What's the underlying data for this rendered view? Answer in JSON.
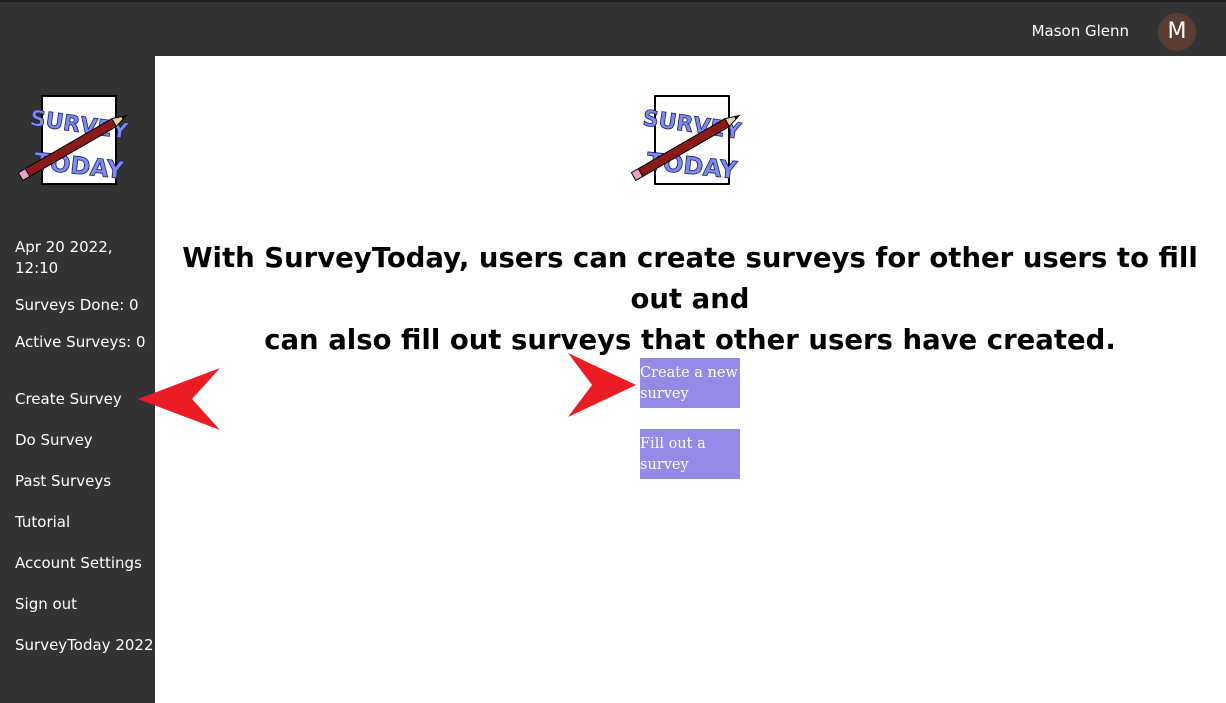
{
  "header": {
    "user_name": "Mason Glenn",
    "avatar_initial": "M"
  },
  "sidebar": {
    "datetime_line1": "Apr 20 2022,",
    "datetime_line2": "12:10",
    "surveys_done": "Surveys Done: 0",
    "active_surveys": "Active Surveys: 0",
    "nav": [
      {
        "label": "Create Survey"
      },
      {
        "label": "Do Survey"
      },
      {
        "label": "Past Surveys"
      },
      {
        "label": "Tutorial"
      },
      {
        "label": "Account Settings"
      },
      {
        "label": "Sign out"
      },
      {
        "label": "SurveyToday 2022"
      }
    ]
  },
  "main": {
    "headline_line1": "With SurveyToday, users can create surveys for other users to fill out and",
    "headline_line2": "can also fill out surveys that other users have created.",
    "create_button": {
      "line1": "Create a new",
      "line2": "survey"
    },
    "fill_button": {
      "line1": "Fill out a",
      "line2": "survey"
    }
  },
  "logo": {
    "text_line1": "SURVEY",
    "text_line2": "TODAY"
  },
  "colors": {
    "chrome": "#333333",
    "button": "#9389e6",
    "avatar": "#5a3d33",
    "annotation_arrow": "#ec1c24",
    "logo_letters": "#7a8cf0",
    "pencil": "#8b1a1a"
  }
}
